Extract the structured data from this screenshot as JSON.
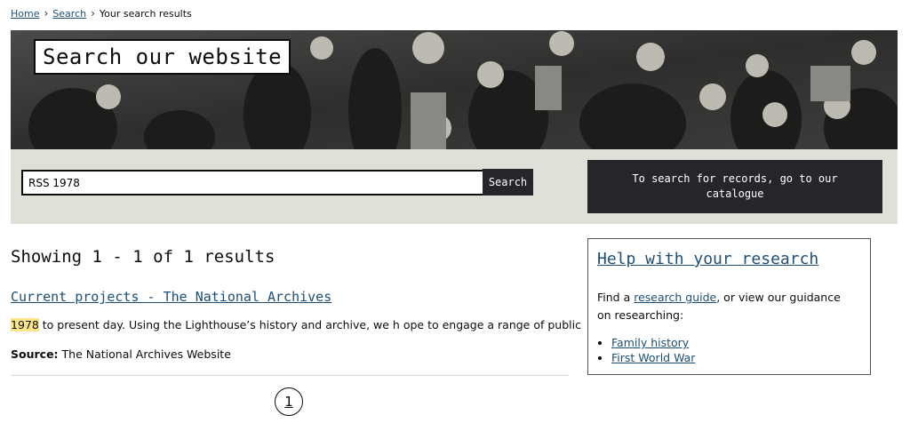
{
  "breadcrumb": {
    "home": "Home",
    "search": "Search",
    "current": "Your search results"
  },
  "hero": {
    "title": "Search our website"
  },
  "search": {
    "value": "RSS 1978",
    "button": "Search",
    "catalogue": "To search for records, go to our catalogue"
  },
  "results": {
    "heading": "Showing 1 - 1 of 1 results",
    "items": [
      {
        "title": "Current projects - The National Archives",
        "highlight": "1978",
        "snippet": " to present day. Using the Lighthouse’s history and archive, we h ope to engage a range of public",
        "source_label": "Source:",
        "source": " The National Archives Website"
      }
    ]
  },
  "pagination": {
    "current": "1"
  },
  "help": {
    "title": "Help with your research",
    "text_before": "Find a ",
    "link": "research guide",
    "text_after": ", or view our guidance on researching:",
    "links": [
      "Family history",
      "First World War"
    ]
  }
}
